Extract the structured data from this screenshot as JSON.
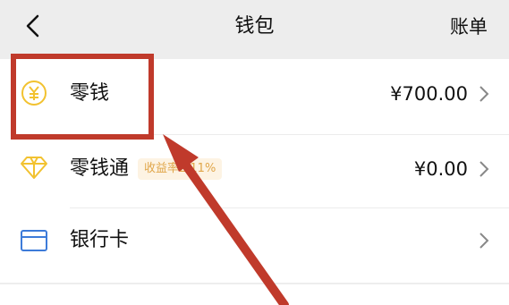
{
  "header": {
    "title": "钱包",
    "bill_label": "账单"
  },
  "rows": [
    {
      "label": "零钱",
      "value": "¥700.00"
    },
    {
      "label": "零钱通",
      "badge": "收益率2.11%",
      "value": "¥0.00"
    },
    {
      "label": "银行卡",
      "value": ""
    }
  ],
  "colors": {
    "coin": "#f2c230",
    "diamond": "#f2c230",
    "card": "#3d7bd9",
    "annotation": "#c03a2b",
    "badge_text": "#e0a64a"
  },
  "icons": [
    "back-chevron-icon",
    "yuan-coin-icon",
    "diamond-icon",
    "bank-card-icon",
    "chevron-right-icon"
  ]
}
